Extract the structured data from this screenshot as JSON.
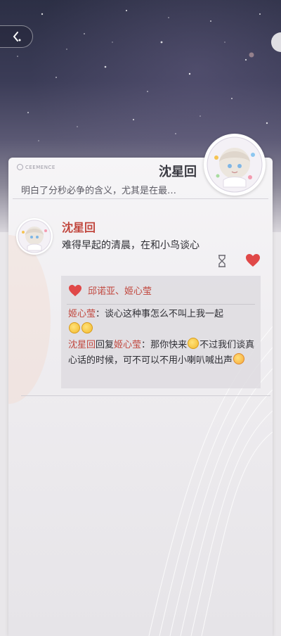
{
  "brand": {
    "label": "CEEMENCE"
  },
  "header": {
    "name": "沈星回",
    "snippet": "明白了分秒必争的含义，尤其是在最…"
  },
  "post": {
    "author": "沈星回",
    "text": "难得早起的清晨，在和小鸟谈心"
  },
  "likes": {
    "names": "邱诺亚、姬心莹"
  },
  "comments": [
    {
      "name": "姬心莹",
      "sep": "：",
      "text": "谈心这种事怎么不叫上我一起"
    },
    {
      "name": "沈星回",
      "reply_word": "回复",
      "reply_to": "姬心莹",
      "sep": "：",
      "text_before": "那你快来",
      "text_after": "不过我们谈真心话的时候，可不可以不用小喇叭喊出声"
    }
  ],
  "colors": {
    "accent_red": "#c1473e",
    "heart": "#e04848"
  },
  "icons": {
    "back": "chevron-left-icon",
    "like": "heart-icon",
    "pending": "hourglass-icon"
  }
}
